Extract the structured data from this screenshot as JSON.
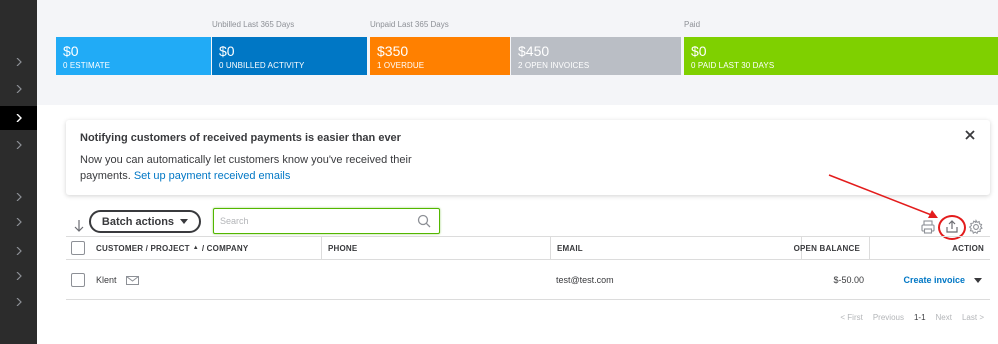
{
  "money_bar": {
    "groups": [
      {
        "label": "Unbilled Last 365 Days"
      },
      {
        "label": "Unpaid Last 365 Days"
      },
      {
        "label": "Paid"
      }
    ],
    "tiles": [
      {
        "amount": "$0",
        "label": "0 ESTIMATE",
        "color": "#21abf6"
      },
      {
        "amount": "$0",
        "label": "0 UNBILLED ACTIVITY",
        "color": "#0077c5"
      },
      {
        "amount": "$350",
        "label": "1 OVERDUE",
        "color": "#ff8000"
      },
      {
        "amount": "$450",
        "label": "2 OPEN INVOICES",
        "color": "#babec5"
      },
      {
        "amount": "$0",
        "label": "0 PAID LAST 30 DAYS",
        "color": "#7fd000"
      }
    ]
  },
  "notice": {
    "title": "Notifying customers of received payments is easier than ever",
    "body": "Now you can automatically let customers know you've received their payments.",
    "link": "Set up payment received emails",
    "close_icon": "close-icon"
  },
  "toolbar": {
    "batch_label": "Batch actions",
    "search_placeholder": "Search",
    "icons": [
      "sort-icon",
      "print-icon",
      "export-icon",
      "settings-icon"
    ]
  },
  "table": {
    "headers": {
      "customer": "CUSTOMER / PROJECT",
      "sort_arrow": "▲",
      "company": "/ COMPANY",
      "phone": "PHONE",
      "email": "EMAIL",
      "balance": "OPEN BALANCE",
      "action": "ACTION"
    },
    "rows": [
      {
        "customer": "Klent",
        "phone": "",
        "email": "test@test.com",
        "balance": "$-50.00",
        "action": "Create invoice"
      }
    ]
  },
  "pager": {
    "first": "< First",
    "previous": "Previous",
    "range": "1-1",
    "next": "Next",
    "last": "Last >"
  },
  "colors": {
    "annotation": "#e31c1c",
    "link": "#0077c5",
    "search_focus": "#53b700"
  }
}
